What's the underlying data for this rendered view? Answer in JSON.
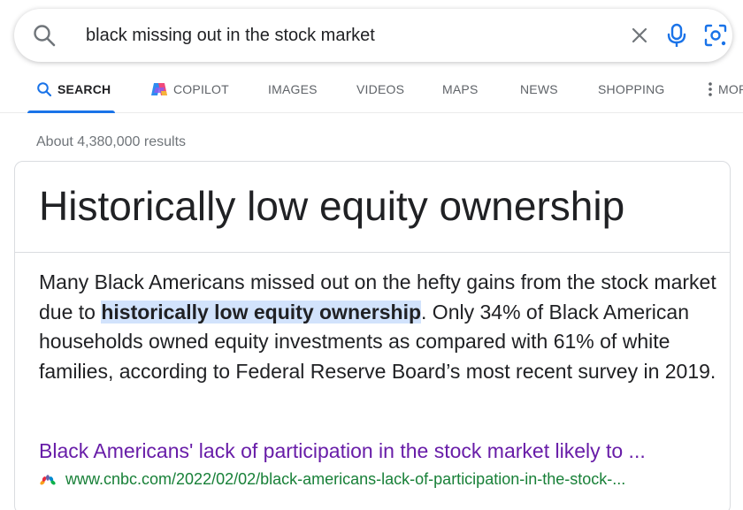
{
  "search": {
    "query": "black missing out in the stock market"
  },
  "tabs": [
    {
      "label": "SEARCH",
      "active": true
    },
    {
      "label": "COPILOT"
    },
    {
      "label": "IMAGES"
    },
    {
      "label": "VIDEOS"
    },
    {
      "label": "MAPS"
    },
    {
      "label": "NEWS"
    },
    {
      "label": "SHOPPING"
    },
    {
      "label": "MOR"
    }
  ],
  "results_count": "About 4,380,000 results",
  "featured": {
    "title": "Historically low equity ownership",
    "snippet_before": "Many Black Americans missed out on the hefty gains from the stock market due to ",
    "snippet_highlight": "historically low equity ownership",
    "snippet_after": ". Only 34% of Black American households owned equity investments as compared with 61% of white families, according to Federal Reserve Board’s most recent survey in 2019.",
    "link_title": "Black Americans' lack of participation in the stock market likely to ...",
    "url": "www.cnbc.com/2022/02/02/black-americans-lack-of-participation-in-the-stock-...",
    "source_icon": "nbc-peacock-icon"
  },
  "colors": {
    "accent": "#1a73e8",
    "link_visited": "#681da8",
    "url_green": "#188038",
    "highlight": "#d2e3fc"
  }
}
